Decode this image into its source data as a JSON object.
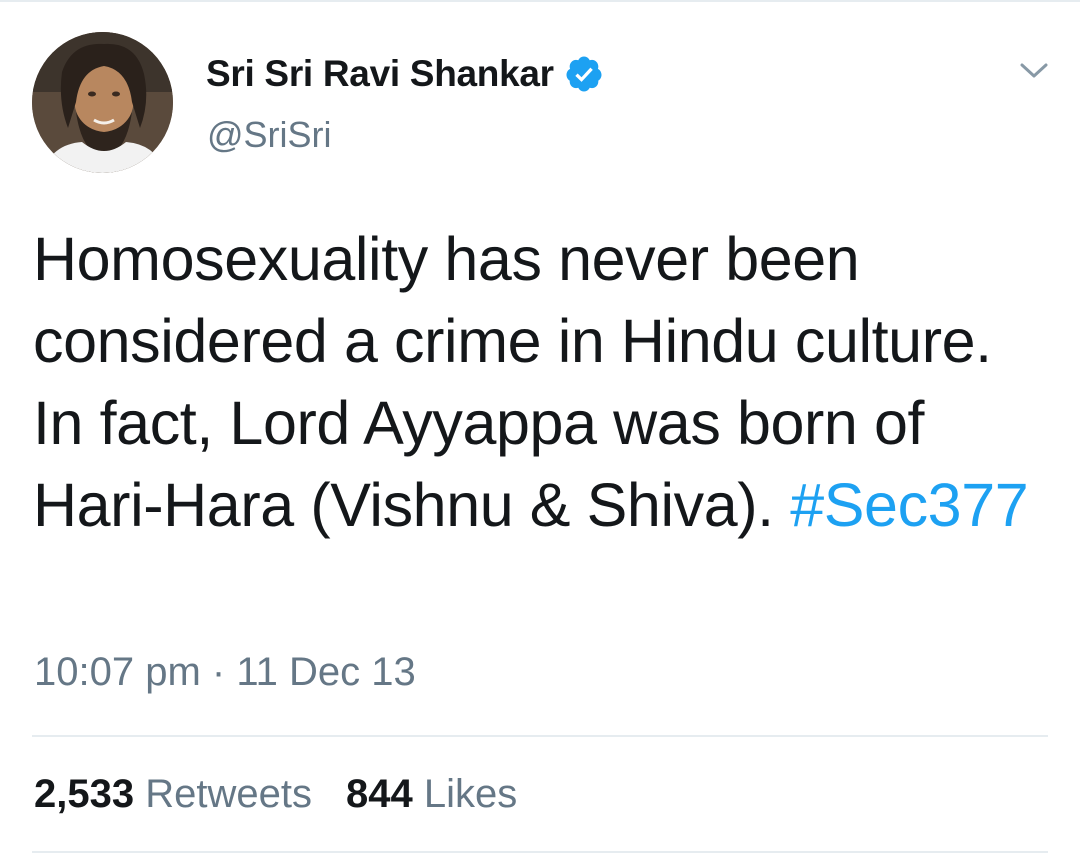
{
  "tweet": {
    "author": {
      "display_name": "Sri Sri Ravi Shankar",
      "handle": "@SriSri",
      "verified": true,
      "avatar_icon": "profile-photo"
    },
    "text_main": "Homosexuality has never been considered a crime in Hindu culture. In fact, Lord Ayyappa was born of Hari-Hara (Vishnu & Shiva).",
    "hashtag": "#Sec377",
    "time": "10:07 pm",
    "separator": "·",
    "date": "11 Dec 13",
    "stats": {
      "retweets_count": "2,533",
      "retweets_label": "Retweets",
      "likes_count": "844",
      "likes_label": "Likes"
    }
  },
  "colors": {
    "accent": "#1da1f2",
    "text_primary": "#14171a",
    "text_secondary": "#657786",
    "divider": "#e6ecf0"
  },
  "icons": {
    "verified": "verified-badge-icon",
    "caret": "chevron-down-icon"
  }
}
